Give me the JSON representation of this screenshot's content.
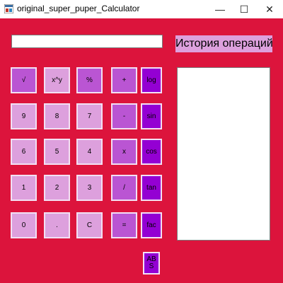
{
  "window": {
    "title": "original_super_puper_Calculator",
    "minimize_glyph": "—",
    "maximize_glyph": "☐",
    "close_glyph": "✕"
  },
  "colors": {
    "background": "#dc143c",
    "light_button": "#dda0dd",
    "medium_button": "#ba55d3",
    "dark_button": "#9400d3"
  },
  "display": {
    "value": ""
  },
  "history": {
    "label": "История операций",
    "content": ""
  },
  "buttons": {
    "sqrt": "√",
    "power": "x^y",
    "percent": "%",
    "plus": "+",
    "log": "log",
    "nine": "9",
    "eight": "8",
    "seven": "7",
    "minus": "-",
    "sin": "sin",
    "six": "6",
    "five": "5",
    "four": "4",
    "multiply": "x",
    "cos": "cos",
    "one": "1",
    "two": "2",
    "three": "3",
    "divide": "/",
    "tan": "tan",
    "zero": "0",
    "dot": ".",
    "clear": "C",
    "equals": "=",
    "factorial": "fac",
    "abs": "AB S"
  }
}
